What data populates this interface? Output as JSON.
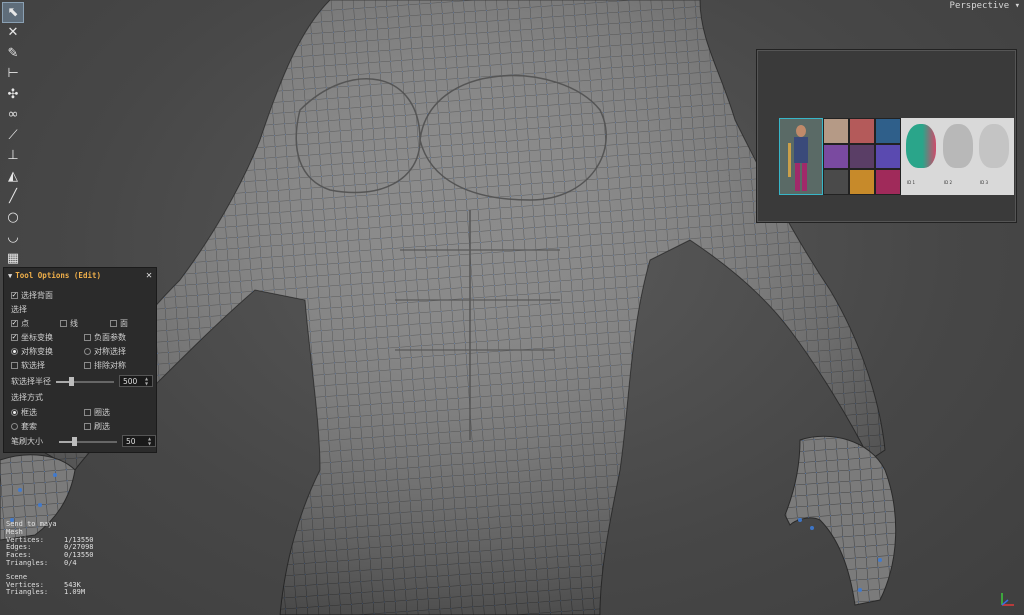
{
  "viewport": {
    "camera_label": "Perspective",
    "camera_dropdown_icon": "chevron-down-icon",
    "mesh_wire_color": "#3d7bd6",
    "mesh_body_color": "#7d7d7d",
    "background_color": "#4b4b4b"
  },
  "toolbar": {
    "tools": [
      {
        "name": "select-tool",
        "icon": "arrow-cursor-icon",
        "glyph": "⬉",
        "active": true
      },
      {
        "name": "transform-tool",
        "icon": "cross-arrows-icon",
        "glyph": "✕"
      },
      {
        "name": "pen-tool",
        "icon": "pencil-icon",
        "glyph": "✎"
      },
      {
        "name": "measure-tool",
        "icon": "ruler-icon",
        "glyph": "⊢"
      },
      {
        "name": "move-tool",
        "icon": "move-icon",
        "glyph": "✣"
      },
      {
        "name": "lasso-tool",
        "icon": "lasso-icon",
        "glyph": "∞"
      },
      {
        "name": "brush-tool",
        "icon": "brush-icon",
        "glyph": "⟋"
      },
      {
        "name": "pivot-tool",
        "icon": "pivot-icon",
        "glyph": "⊥"
      },
      {
        "name": "paint-tool",
        "icon": "paint-icon",
        "glyph": "◭"
      },
      {
        "name": "line-tool",
        "icon": "line-icon",
        "glyph": "╱"
      },
      {
        "name": "circle-tool",
        "icon": "circle-icon",
        "glyph": "○"
      },
      {
        "name": "curve-tool",
        "icon": "curve-icon",
        "glyph": "◡"
      },
      {
        "name": "grid-tool",
        "icon": "grid-icon",
        "glyph": "▦"
      }
    ]
  },
  "tool_options": {
    "title": "Tool Options (Edit)",
    "collapse_icon": "triangle-down-icon",
    "close_glyph": "✕",
    "select_backfaces_label": "选择背面",
    "select_backfaces_checked": true,
    "selection_section": "选择",
    "component_point": "点",
    "component_edge": "线",
    "component_face": "面",
    "coord_transform": "坐标变换",
    "negative_params": "负面参数",
    "symmetric_transform": "对称变换",
    "symmetric_select": "对称选择",
    "soft_select": "软选择",
    "exclude_symmetry": "排除对称",
    "soft_radius_label": "软选择半径",
    "soft_radius_value": "500",
    "soft_radius_fraction": 0.25,
    "select_mode_section": "选择方式",
    "mode_click": "框选",
    "mode_circle": "圈选",
    "mode_lasso": "套索",
    "mode_brush": "刷选",
    "brush_size_label": "笔刷大小",
    "brush_size_value": "50",
    "brush_size_fraction": 0.25
  },
  "hud": {
    "title": "Send to maya",
    "mesh_heading": "Mesh",
    "vertices_label": "Vertices:",
    "vertices_value": "1/13550",
    "edges_label": "Edges:",
    "edges_value": "0/27098",
    "faces_label": "Faces:",
    "faces_value": "0/13550",
    "triangles_label": "Triangles:",
    "triangles_value": "0/4",
    "scene_heading": "Scene",
    "scene_vertices_label": "Vertices:",
    "scene_vertices_value": "543K",
    "scene_triangles_label": "Triangles:",
    "scene_triangles_value": "1.09M"
  },
  "reference_panel": {
    "captions": [
      "ID 1",
      "ID 2",
      "ID 3"
    ]
  }
}
